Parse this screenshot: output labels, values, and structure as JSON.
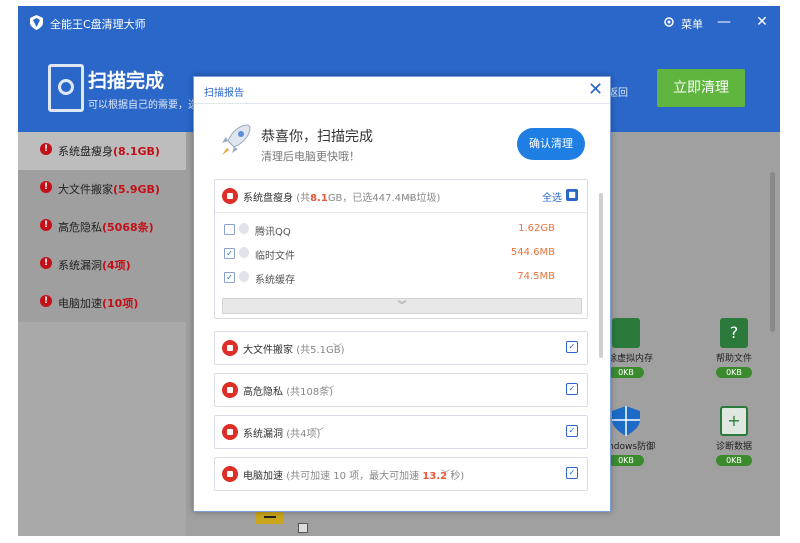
{
  "window": {
    "title": "全能王C盘清理大师",
    "menu_label": "菜单",
    "minimize": "—",
    "close": "✕"
  },
  "header": {
    "scan_title": "扫描完成",
    "scan_subtitle": "可以根据自己的需要，选择",
    "back_label": "返回",
    "clean_now": "立即清理"
  },
  "sidebar": {
    "items": [
      {
        "label": "系统盘瘦身",
        "value": "(8.1GB)"
      },
      {
        "label": "大文件搬家",
        "value": "(5.9GB)"
      },
      {
        "label": "高危隐私",
        "value": "(5068条)"
      },
      {
        "label": "系统漏洞",
        "value": "(4项)"
      },
      {
        "label": "电脑加速",
        "value": "(10项)"
      }
    ]
  },
  "tools": [
    {
      "label": "清除虚拟内存",
      "size": "0KB",
      "icon": "memory-icon",
      "color": "#2b7a3c"
    },
    {
      "label": "帮助文件",
      "size": "0KB",
      "icon": "help-file-icon",
      "color": "#2b7a3c"
    },
    {
      "label": "Windows防御",
      "size": "0KB",
      "icon": "shield-icon",
      "color": "#1b6bc7"
    },
    {
      "label": "诊断数据",
      "size": "0KB",
      "icon": "diagnostic-icon",
      "color": "#2b7a3c"
    }
  ],
  "dialog": {
    "title": "扫描报告",
    "close": "✕",
    "heading": "恭喜你，扫描完成",
    "subheading": "清理后电脑更快哦！",
    "confirm_button": "确认清理",
    "sections": [
      {
        "title": "系统盘瘦身",
        "detail_prefix": "(共",
        "detail_highlight": "8.1",
        "detail_suffix": "GB，已选447.4MB垃圾)",
        "select_all": "全选",
        "expanded": true,
        "rows": [
          {
            "name": "腾讯QQ",
            "size": "1.62GB",
            "checked": false
          },
          {
            "name": "临时文件",
            "size": "544.6MB",
            "checked": true
          },
          {
            "name": "系统缓存",
            "size": "74.5MB",
            "checked": true
          }
        ]
      },
      {
        "title": "大文件搬家",
        "detail": "(共5.1GB)"
      },
      {
        "title": "高危隐私",
        "detail": "(共108条)"
      },
      {
        "title": "系统漏洞",
        "detail": "(共4项)"
      },
      {
        "title": "电脑加速",
        "detail_prefix": "(共可加速 10 项，最大可加速",
        "detail_highlight": "13.2",
        "detail_suffix": "秒)"
      }
    ]
  }
}
